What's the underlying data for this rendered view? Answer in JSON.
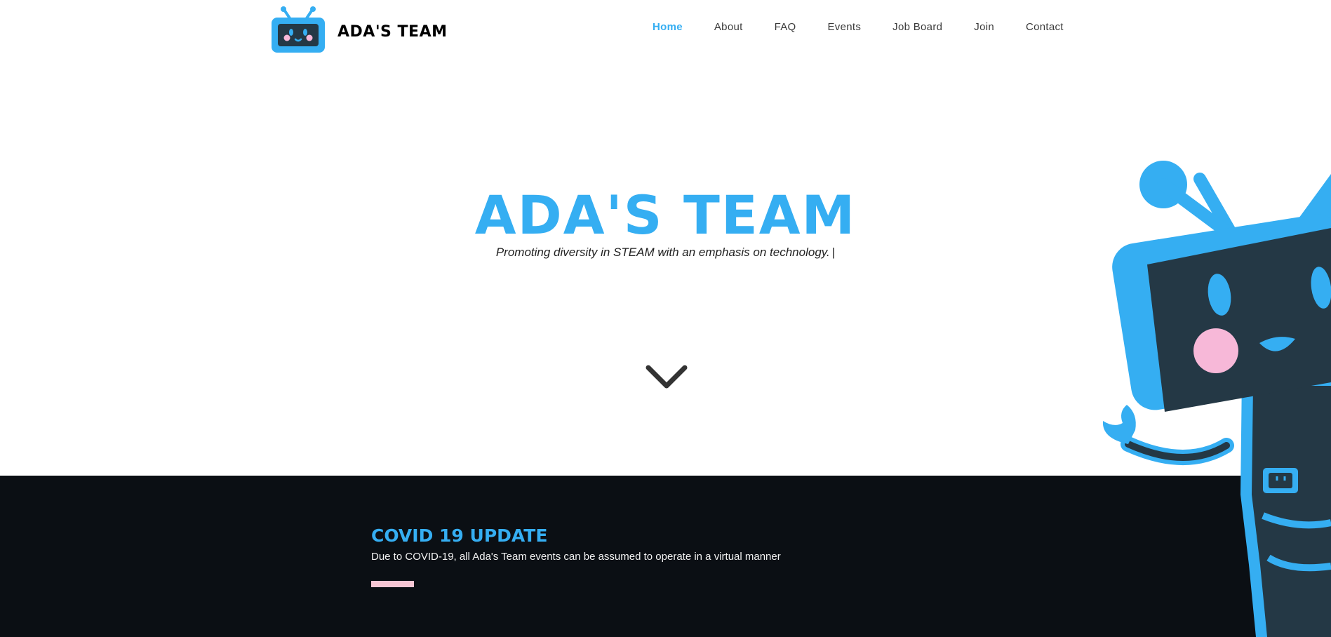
{
  "header": {
    "brand": "ADA'S TEAM",
    "logo_icon": "robot-tv-logo-icon"
  },
  "nav": {
    "items": [
      {
        "label": "Home",
        "active": true
      },
      {
        "label": "About"
      },
      {
        "label": "FAQ"
      },
      {
        "label": "Events"
      },
      {
        "label": "Job Board"
      },
      {
        "label": "Join"
      },
      {
        "label": "Contact"
      }
    ]
  },
  "hero": {
    "title": "ADA'S TEAM",
    "subtitle": "Promoting diversity in STEAM with an emphasis on technology.",
    "cursor": "|",
    "scroll_icon": "chevron-down-icon"
  },
  "covid": {
    "title": "COVID 19 UPDATE",
    "text": "Due to COVID-19, all Ada's Team events can be assumed to operate in a virtual manner"
  },
  "colors": {
    "accent": "#35aef2",
    "dark_bg": "#0b0f14",
    "pink": "#f7c6d4",
    "screen": "#243845"
  }
}
